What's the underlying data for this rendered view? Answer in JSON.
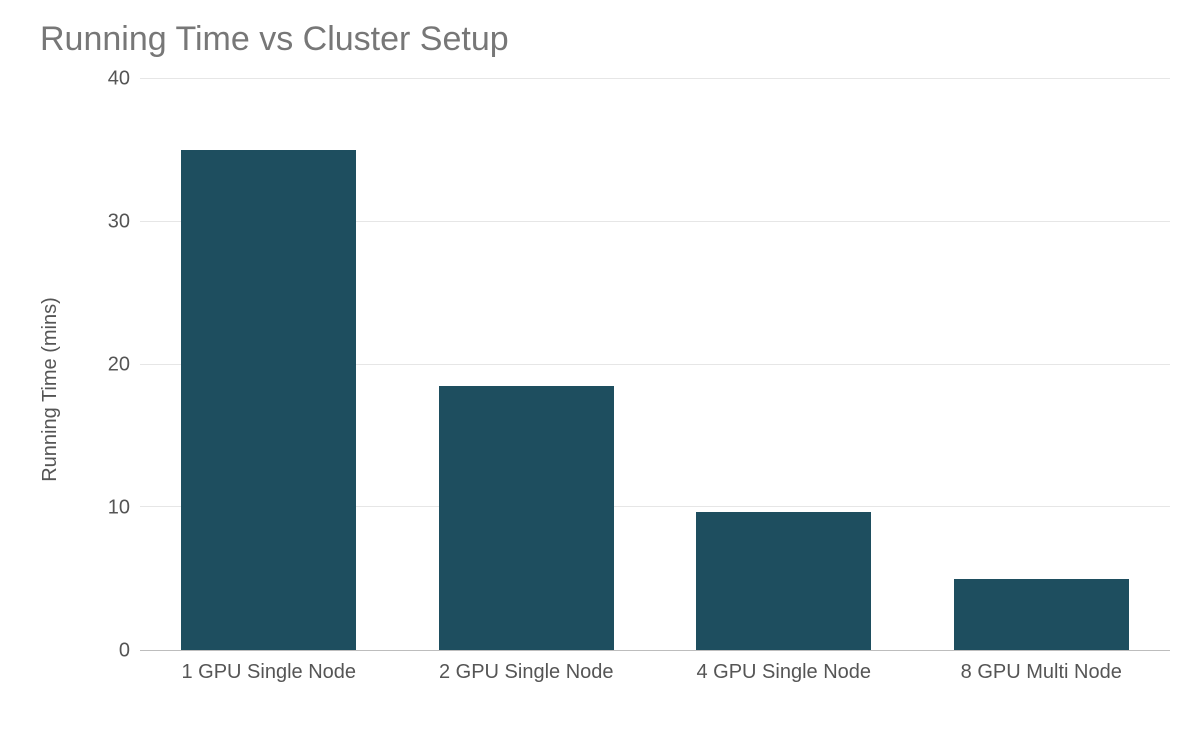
{
  "chart_data": {
    "type": "bar",
    "title": "Running Time vs Cluster Setup",
    "ylabel": "Running Time (mins)",
    "xlabel": "",
    "ylim": [
      0,
      40
    ],
    "yticks": [
      0,
      10,
      20,
      30,
      40
    ],
    "categories": [
      "1 GPU Single Node",
      "2 GPU Single Node",
      "4 GPU Single Node",
      "8 GPU Multi Node"
    ],
    "values": [
      35,
      18.5,
      9.7,
      5
    ],
    "bar_color": "#1e4e5f"
  }
}
